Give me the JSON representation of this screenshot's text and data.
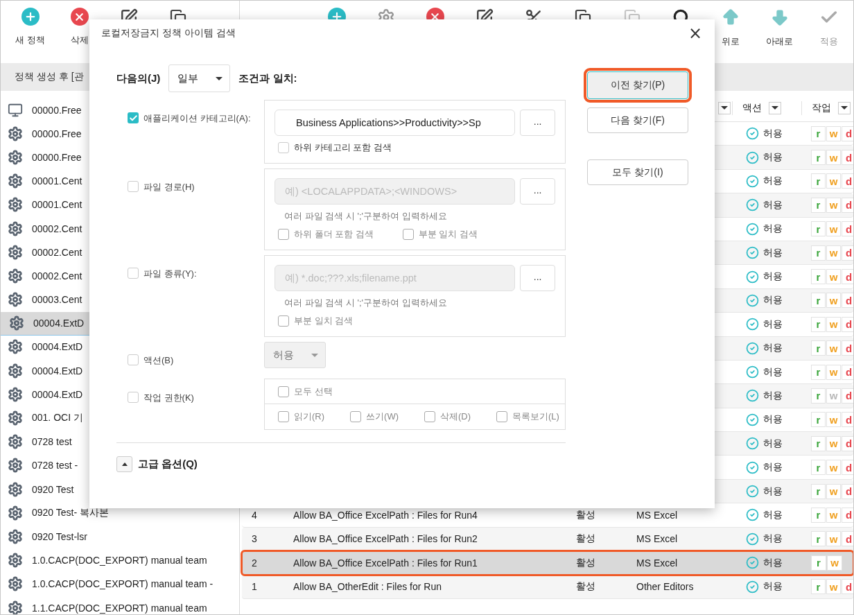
{
  "toolbar": {
    "left": [
      {
        "label": "새 정책"
      },
      {
        "label": "삭제"
      }
    ],
    "right": [
      {
        "label": "위로",
        "disabled": false
      },
      {
        "label": "아래로",
        "disabled": false
      },
      {
        "label": "적용",
        "disabled": true
      }
    ]
  },
  "header_bar": {
    "title": "정책 생성 후 [관"
  },
  "sidebar": {
    "items": [
      {
        "label": "00000.Free",
        "selected": false
      },
      {
        "label": "00000.Free",
        "selected": false
      },
      {
        "label": "00000.Free",
        "selected": false
      },
      {
        "label": "00001.Cent",
        "selected": false
      },
      {
        "label": "00001.Cent",
        "selected": false
      },
      {
        "label": "00002.Cent",
        "selected": false
      },
      {
        "label": "00002.Cent",
        "selected": false
      },
      {
        "label": "00002.Cent",
        "selected": false
      },
      {
        "label": "00003.Cent",
        "selected": false
      },
      {
        "label": "00004.ExtD",
        "selected": true
      },
      {
        "label": "00004.ExtD",
        "selected": false
      },
      {
        "label": "00004.ExtD",
        "selected": false
      },
      {
        "label": "00004.ExtD",
        "selected": false
      },
      {
        "label": "001. OCI 기",
        "selected": false
      },
      {
        "label": "0728 test",
        "selected": false
      },
      {
        "label": "0728 test -",
        "selected": false
      },
      {
        "label": "0920 Test",
        "selected": false
      },
      {
        "label": "0920 Test- 복사본",
        "selected": false
      },
      {
        "label": "0920 Test-lsr",
        "selected": false
      },
      {
        "label": "1.0.CACP(DOC_EXPORT) manual team",
        "selected": false
      },
      {
        "label": "1.0.CACP(DOC_EXPORT) manual team -",
        "selected": false
      },
      {
        "label": "1.1.CACP(DOC_EXPORT) manual team",
        "selected": false
      }
    ]
  },
  "table": {
    "columns": [
      {
        "label": "액션"
      },
      {
        "label": "작업"
      }
    ],
    "rows": [
      {
        "action": "허용",
        "perms": [
          {
            "letter": "r",
            "enabled": true
          },
          {
            "letter": "w",
            "enabled": true
          },
          {
            "letter": "d",
            "enabled": true
          }
        ],
        "selected": false,
        "highlighted": false
      },
      {
        "action": "허용",
        "perms": [
          {
            "letter": "r",
            "enabled": true
          },
          {
            "letter": "w",
            "enabled": true
          },
          {
            "letter": "d",
            "enabled": true
          }
        ],
        "selected": false,
        "highlighted": false
      },
      {
        "action": "허용",
        "perms": [
          {
            "letter": "r",
            "enabled": true
          },
          {
            "letter": "w",
            "enabled": true
          },
          {
            "letter": "d",
            "enabled": true
          }
        ],
        "selected": false,
        "highlighted": false
      },
      {
        "action": "허용",
        "perms": [
          {
            "letter": "r",
            "enabled": true
          },
          {
            "letter": "w",
            "enabled": true
          },
          {
            "letter": "d",
            "enabled": true
          }
        ],
        "selected": false,
        "highlighted": false
      },
      {
        "action": "허용",
        "perms": [
          {
            "letter": "r",
            "enabled": true
          },
          {
            "letter": "w",
            "enabled": true
          },
          {
            "letter": "d",
            "enabled": true
          }
        ],
        "selected": false,
        "highlighted": false
      },
      {
        "action": "허용",
        "perms": [
          {
            "letter": "r",
            "enabled": true
          },
          {
            "letter": "w",
            "enabled": true
          },
          {
            "letter": "d",
            "enabled": true
          }
        ],
        "selected": false,
        "highlighted": false
      },
      {
        "action": "허용",
        "perms": [
          {
            "letter": "r",
            "enabled": true
          },
          {
            "letter": "w",
            "enabled": true
          },
          {
            "letter": "d",
            "enabled": true
          }
        ],
        "selected": false,
        "highlighted": false
      },
      {
        "action": "허용",
        "perms": [
          {
            "letter": "r",
            "enabled": true
          },
          {
            "letter": "w",
            "enabled": true
          },
          {
            "letter": "d",
            "enabled": true
          }
        ],
        "selected": false,
        "highlighted": false
      },
      {
        "action": "허용",
        "perms": [
          {
            "letter": "r",
            "enabled": true
          },
          {
            "letter": "w",
            "enabled": true
          },
          {
            "letter": "d",
            "enabled": true
          }
        ],
        "selected": false,
        "highlighted": false
      },
      {
        "action": "허용",
        "perms": [
          {
            "letter": "r",
            "enabled": true
          },
          {
            "letter": "w",
            "enabled": true
          },
          {
            "letter": "d",
            "enabled": true
          }
        ],
        "selected": false,
        "highlighted": false
      },
      {
        "action": "허용",
        "perms": [
          {
            "letter": "r",
            "enabled": true
          },
          {
            "letter": "w",
            "enabled": true
          },
          {
            "letter": "d",
            "enabled": true
          }
        ],
        "selected": false,
        "highlighted": false
      },
      {
        "action": "허용",
        "perms": [
          {
            "letter": "r",
            "enabled": true
          },
          {
            "letter": "w",
            "enabled": false
          },
          {
            "letter": "d",
            "enabled": true
          }
        ],
        "selected": false,
        "highlighted": false
      },
      {
        "action": "허용",
        "perms": [
          {
            "letter": "r",
            "enabled": true
          },
          {
            "letter": "w",
            "enabled": true
          },
          {
            "letter": "d",
            "enabled": true
          }
        ],
        "selected": false,
        "highlighted": false
      },
      {
        "action": "허용",
        "perms": [
          {
            "letter": "r",
            "enabled": true
          },
          {
            "letter": "w",
            "enabled": true
          },
          {
            "letter": "d",
            "enabled": true
          }
        ],
        "selected": false,
        "highlighted": false
      },
      {
        "action": "허용",
        "perms": [
          {
            "letter": "r",
            "enabled": true
          },
          {
            "letter": "w",
            "enabled": true
          },
          {
            "letter": "d",
            "enabled": true
          }
        ],
        "selected": false,
        "highlighted": false
      },
      {
        "action": "허용",
        "perms": [
          {
            "letter": "r",
            "enabled": true
          },
          {
            "letter": "w",
            "enabled": true
          },
          {
            "letter": "d",
            "enabled": true
          }
        ],
        "selected": false,
        "highlighted": false
      },
      {
        "number": "4",
        "name": "Allow BA_Office ExcelPath : Files for Run4",
        "status": "활성",
        "app": "MS Excel",
        "action": "허용",
        "perms": [
          {
            "letter": "r",
            "enabled": true
          },
          {
            "letter": "w",
            "enabled": true
          },
          {
            "letter": "d",
            "enabled": true
          }
        ],
        "selected": false,
        "highlighted": false
      },
      {
        "number": "3",
        "name": "Allow BA_Office ExcelPath : Files for Run2",
        "status": "활성",
        "app": "MS Excel",
        "action": "허용",
        "perms": [
          {
            "letter": "r",
            "enabled": true
          },
          {
            "letter": "w",
            "enabled": true
          },
          {
            "letter": "d",
            "enabled": true
          }
        ],
        "selected": false,
        "highlighted": false
      },
      {
        "number": "2",
        "name": "Allow BA_Office ExcelPath : Files for Run1",
        "status": "활성",
        "app": "MS Excel",
        "action": "허용",
        "perms": [
          {
            "letter": "r",
            "enabled": true
          },
          {
            "letter": "w",
            "enabled": true
          }
        ],
        "selected": true,
        "highlighted": true
      },
      {
        "number": "1",
        "name": "Allow BA_OtherEdit : Files for Run",
        "status": "활성",
        "app": "Other Editors",
        "action": "허용",
        "perms": [
          {
            "letter": "r",
            "enabled": true
          },
          {
            "letter": "w",
            "enabled": true
          },
          {
            "letter": "d",
            "enabled": true
          }
        ],
        "selected": false,
        "highlighted": false
      }
    ]
  },
  "dialog": {
    "title": "로컬저장금지 정책 아이템 검색",
    "close": "×",
    "match": {
      "label": "다음의(J)",
      "value": "일부",
      "suffix": "조건과 일치:"
    },
    "conditions": [
      {
        "kind": "text",
        "label": "애플리케이션 카테고리(A):",
        "checked": true,
        "value": "Business Applications>>Productivity>>Sp",
        "browse": "...",
        "options": [
          {
            "label": "하위 카테고리 포함 검색",
            "checked": false
          }
        ]
      },
      {
        "kind": "text",
        "label": "파일 경로(H)",
        "checked": false,
        "placeholder": "예) <LOCALAPPDATA>;<WINDOWS>",
        "browse": "...",
        "hint": "여러 파일 검색 시 ';'구분하여 입력하세요",
        "options": [
          {
            "label": "하위 폴더 포함 검색",
            "checked": false
          },
          {
            "label": "부분 일치 검색",
            "checked": false
          }
        ]
      },
      {
        "kind": "text",
        "label": "파일 종류(Y):",
        "checked": false,
        "placeholder": "예) *.doc;???.xls;filename.ppt",
        "browse": "...",
        "hint": "여러 파일 검색 시 ';'구분하여 입력하세요",
        "options": [
          {
            "label": "부분 일치 검색",
            "checked": false
          }
        ]
      },
      {
        "kind": "select",
        "label": "액션(B)",
        "checked": false,
        "value": "허용"
      },
      {
        "kind": "perms",
        "label": "작업 권한(K)",
        "checked": false,
        "all": {
          "label": "모두 선택",
          "checked": false
        },
        "options": [
          {
            "label": "읽기(R)",
            "checked": false
          },
          {
            "label": "쓰기(W)",
            "checked": false
          },
          {
            "label": "삭제(D)",
            "checked": false
          },
          {
            "label": "목록보기(L)",
            "checked": false
          }
        ]
      }
    ],
    "advanced": {
      "label": "고급 옵션(Q)"
    },
    "buttons": [
      {
        "label": "이전 찾기(P)",
        "focused": true,
        "highlighted": true
      },
      {
        "label": "다음 찾기(F)",
        "focused": false,
        "highlighted": false
      },
      {
        "label": "모두 찾기(I)",
        "focused": false,
        "highlighted": false
      }
    ]
  }
}
